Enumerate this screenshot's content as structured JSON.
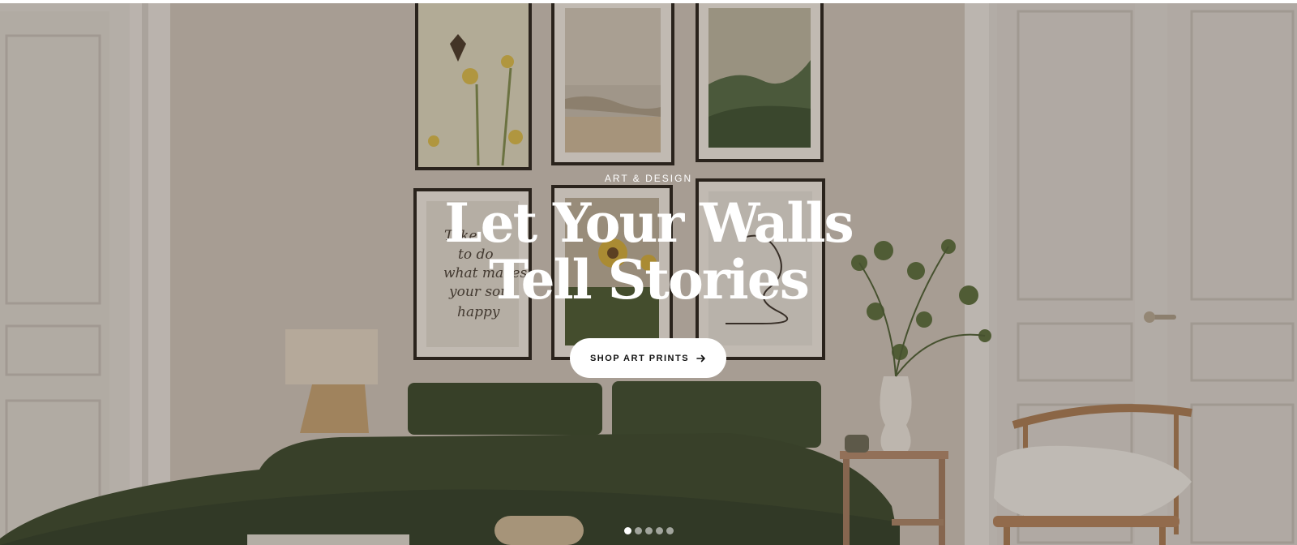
{
  "hero": {
    "eyebrow": "ART & DESIGN",
    "headline_line1": "Let Your Walls",
    "headline_line2": "Tell Stories",
    "cta_label": "SHOP ART PRINTS",
    "cta_icon": "arrow-right-icon",
    "artwork_text": [
      "Take",
      "to do",
      "what makes",
      "your soul",
      "happy"
    ]
  },
  "slider": {
    "slide_count": 5,
    "active_slide": 1
  },
  "colors": {
    "headline": "#ffffff",
    "cta_background": "#ffffff",
    "cta_text": "#111111",
    "bedding": "#3c4a2d",
    "wall": "#c9bfb3"
  }
}
